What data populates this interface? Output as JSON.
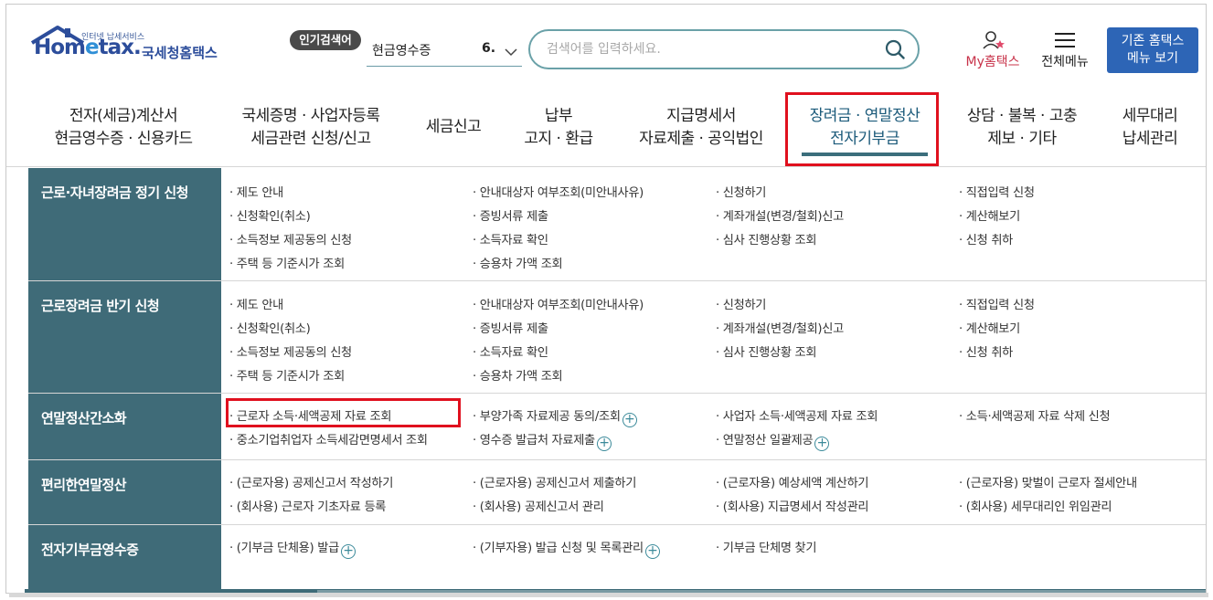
{
  "header": {
    "logo_small": "인터넷 납세서비스",
    "logo_main_a": "Hom",
    "logo_main_e": "e",
    "logo_main_b": "tax.",
    "logo_kr": "국세청홈택스",
    "popular_label": "인기검색어",
    "popular_value": "현금영수증",
    "popular_rank": "6.",
    "search_placeholder": "검색어를 입력하세요.",
    "my_label": "My홈택스",
    "menu_label": "전체메뉴",
    "old_site_line1": "기존 홈택스",
    "old_site_line2": "메뉴 보기"
  },
  "nav": [
    {
      "line1": "전자(세금)계산서",
      "line2": "현금영수증 · 신용카드"
    },
    {
      "line1": "국세증명 · 사업자등록",
      "line2": "세금관련 신청/신고"
    },
    {
      "line1": "세금신고",
      "line2": ""
    },
    {
      "line1": "납부",
      "line2": "고지 · 환급"
    },
    {
      "line1": "지급명세서",
      "line2": "자료제출 · 공익법인"
    },
    {
      "line1": "장려금 · 연말정산",
      "line2": "전자기부금"
    },
    {
      "line1": "상담 · 불복 · 고충",
      "line2": "제보 · 기타"
    },
    {
      "line1": "세무대리",
      "line2": "납세관리"
    }
  ],
  "sections": [
    {
      "title": "근로·자녀장려금 정기 신청",
      "items": [
        [
          "· 제도 안내",
          "· 안내대상자 여부조회(미안내사유)",
          "· 신청하기",
          "· 직접입력 신청"
        ],
        [
          "· 신청확인(취소)",
          "· 증빙서류 제출",
          "· 계좌개설(변경/철회)신고",
          "· 계산해보기"
        ],
        [
          "· 소득정보 제공동의 신청",
          "· 소득자료 확인",
          "· 심사 진행상황 조회",
          "· 신청 취하"
        ],
        [
          "· 주택 등 기준시가 조회",
          "· 승용차 가액 조회",
          "",
          ""
        ]
      ]
    },
    {
      "title": "근로장려금 반기 신청",
      "items": [
        [
          "· 제도 안내",
          "· 안내대상자 여부조회(미안내사유)",
          "· 신청하기",
          "· 직접입력 신청"
        ],
        [
          "· 신청확인(취소)",
          "· 증빙서류 제출",
          "· 계좌개설(변경/철회)신고",
          "· 계산해보기"
        ],
        [
          "· 소득정보 제공동의 신청",
          "· 소득자료 확인",
          "· 심사 진행상황 조회",
          "· 신청 취하"
        ],
        [
          "· 주택 등 기준시가 조회",
          "· 승용차 가액 조회",
          "",
          ""
        ]
      ]
    },
    {
      "title": "연말정산간소화",
      "items": [
        [
          "· 근로자 소득·세액공제 자료 조회",
          "· 부양가족 자료제공 동의/조회",
          "· 사업자 소득·세액공제 자료 조회",
          "· 소득·세액공제 자료 삭제 신청"
        ],
        [
          "· 중소기업취업자 소득세감면명세서 조회",
          "· 영수증 발급처 자료제출",
          "· 연말정산 일괄제공",
          ""
        ]
      ]
    },
    {
      "title": "편리한연말정산",
      "items": [
        [
          "· (근로자용) 공제신고서 작성하기",
          "· (근로자용) 공제신고서 제출하기",
          "· (근로자용) 예상세액 계산하기",
          "· (근로자용) 맞벌이 근로자 절세안내"
        ],
        [
          "· (회사용) 근로자 기초자료 등록",
          "· (회사용) 공제신고서 관리",
          "· (회사용) 지급명세서 작성관리",
          "· (회사용) 세무대리인 위임관리"
        ]
      ]
    },
    {
      "title": "전자기부금영수증",
      "items": [
        [
          "· (기부금 단체용) 발급",
          "· (기부자용) 발급 신청 및 목록관리",
          "· 기부금 단체명 찾기",
          ""
        ]
      ]
    }
  ],
  "plus_symbol": "+"
}
